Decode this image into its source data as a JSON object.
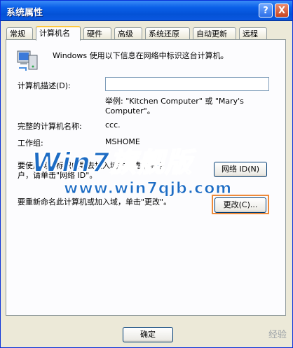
{
  "window": {
    "title": "系统属性",
    "help_label": "?",
    "close_label": "X"
  },
  "tabs": [
    "常规",
    "计算机名",
    "硬件",
    "高级",
    "系统还原",
    "自动更新",
    "远程"
  ],
  "panel": {
    "intro": "Windows 使用以下信息在网络中标识这台计算机。",
    "desc_label": "计算机描述(D):",
    "desc_value": "",
    "example": "举例: \"Kitchen Computer\" 或 \"Mary's Computer\"。",
    "fullname_label": "完整的计算机名称:",
    "fullname_value": "ccc.",
    "workgroup_label": "工作组:",
    "workgroup_value": "MSHOME",
    "network_text_1": "要使用网络标识向导去加入域并创建本地用",
    "network_text_2": "户，请单击\"网络 ID\"。",
    "network_id_button": "网络 ID(N)",
    "rename_text": "要重新命名此计算机或加入域，单击\"更改\"。",
    "change_button": "更改(C)..."
  },
  "footer": {
    "ok_button": "确定"
  },
  "watermark": {
    "title": "Win7旗舰版",
    "url": "www.win7qjb.com",
    "credit": "经验"
  }
}
